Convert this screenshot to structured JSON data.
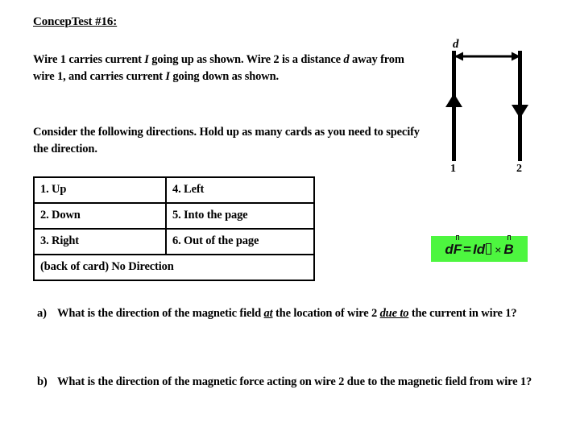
{
  "slide": {
    "title": "ConcepTest #16:",
    "intro_paragraph": {
      "segment_1": "Wire  1 carries current ",
      "var_I_1": "I",
      "segment_2": " going up as shown.  Wire 2 is a distance ",
      "var_d": "d",
      "segment_3": " away from wire 1, and carries current ",
      "var_I_2": "I",
      "segment_4": " going down as shown."
    },
    "directions_paragraph": "Consider the following directions.  Hold up as many cards as you need to specify the direction.",
    "options": {
      "rows": [
        {
          "left": "1.  Up",
          "right": "4.  Left"
        },
        {
          "left": "2.  Down",
          "right": "5.  Into the page"
        },
        {
          "left": "3.  Right",
          "right": "6.  Out of the page"
        }
      ],
      "back_of_card": "(back of card) No Direction"
    },
    "diagram": {
      "distance_label": "d",
      "wire_1_label": "1",
      "wire_2_label": "2",
      "wire_1_direction": "up",
      "wire_2_direction": "down",
      "stroke_color": "#000000"
    },
    "formula_box": {
      "background_color": "#4df63f",
      "d_symbol": "d",
      "force_symbol": "F",
      "equals": "=",
      "current_symbol": "I",
      "length_d": "d",
      "length_l": "l",
      "cross": "×",
      "field_symbol": "B"
    },
    "questions": [
      {
        "marker": "a)",
        "segment_1": "What is the direction of the magnetic field ",
        "emph_1": "at",
        "segment_2": " the location of wire 2 ",
        "emph_2": "due to",
        "segment_3": " the current in wire 1?"
      },
      {
        "marker": "b)",
        "segment_1": "What is the direction of the magnetic force acting on wire 2  due to the magnetic field from wire 1?",
        "emph_1": "",
        "segment_2": "",
        "emph_2": "",
        "segment_3": ""
      }
    ]
  }
}
